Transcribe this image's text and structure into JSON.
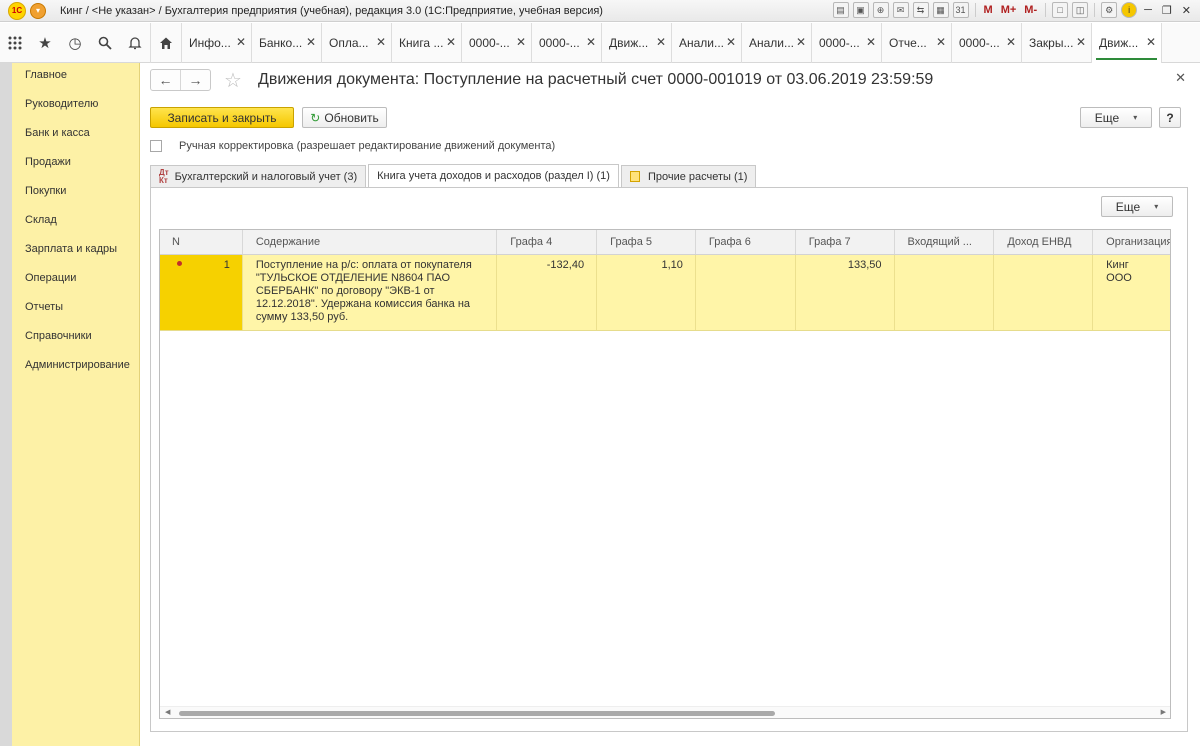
{
  "titlebar": {
    "logo_text": "1С",
    "title": "Кинг / <Не указан> / Бухгалтерия предприятия (учебная), редакция 3.0  (1С:Предприятие, учебная версия)",
    "mem_buttons": [
      "M",
      "M+",
      "M-"
    ]
  },
  "top_tabs": [
    {
      "label": "Инфо..."
    },
    {
      "label": "Банко..."
    },
    {
      "label": "Опла..."
    },
    {
      "label": "Книга ..."
    },
    {
      "label": "0000-..."
    },
    {
      "label": "0000-..."
    },
    {
      "label": "Движ..."
    },
    {
      "label": "Анали..."
    },
    {
      "label": "Анали..."
    },
    {
      "label": "0000-..."
    },
    {
      "label": "Отче..."
    },
    {
      "label": "0000-..."
    },
    {
      "label": "Закры..."
    },
    {
      "label": "Движ...",
      "active": true
    }
  ],
  "sidebar": {
    "items": [
      "Главное",
      "Руководителю",
      "Банк и касса",
      "Продажи",
      "Покупки",
      "Склад",
      "Зарплата и кадры",
      "Операции",
      "Отчеты",
      "Справочники",
      "Администрирование"
    ]
  },
  "form": {
    "title": "Движения документа: Поступление на расчетный счет 0000-001019 от 03.06.2019 23:59:59",
    "save_close_label": "Записать и закрыть",
    "refresh_label": "Обновить",
    "more_label": "Еще",
    "help_label": "?",
    "manual_checkbox_label": "Ручная корректировка (разрешает редактирование движений документа)",
    "manual_checked": false
  },
  "subtabs": [
    {
      "label": "Бухгалтерский и налоговый учет (3)",
      "icon": "dt-kt-icon"
    },
    {
      "label": "Книга учета доходов и расходов (раздел I) (1)",
      "active": true
    },
    {
      "label": "Прочие расчеты (1)",
      "icon": "documents-icon"
    }
  ],
  "grid": {
    "more_label": "Еще",
    "columns": [
      "N",
      "Содержание",
      "Графа 4",
      "Графа 5",
      "Графа 6",
      "Графа 7",
      "Входящий ...",
      "Доход ЕНВД",
      "Организация"
    ],
    "rows": [
      {
        "n": "1",
        "content": "Поступление на р/с: оплата от покупателя \"ТУЛЬСКОЕ ОТДЕЛЕНИЕ N8604 ПАО СБЕРБАНК\" по договору \"ЭКВ-1 от 12.12.2018\". Удержана комиссия банка на сумму 133,50 руб.",
        "g4": "-132,40",
        "g5": "1,10",
        "g6": "",
        "g7": "133,50",
        "incoming": "",
        "envd": "",
        "org": "Кинг ООО"
      }
    ]
  },
  "colors": {
    "sidebar_bg": "#fdf1a6",
    "primary_button": "#f5c700",
    "selected_row": "#fff5a8",
    "active_tab_underline": "#2e8b3a"
  }
}
